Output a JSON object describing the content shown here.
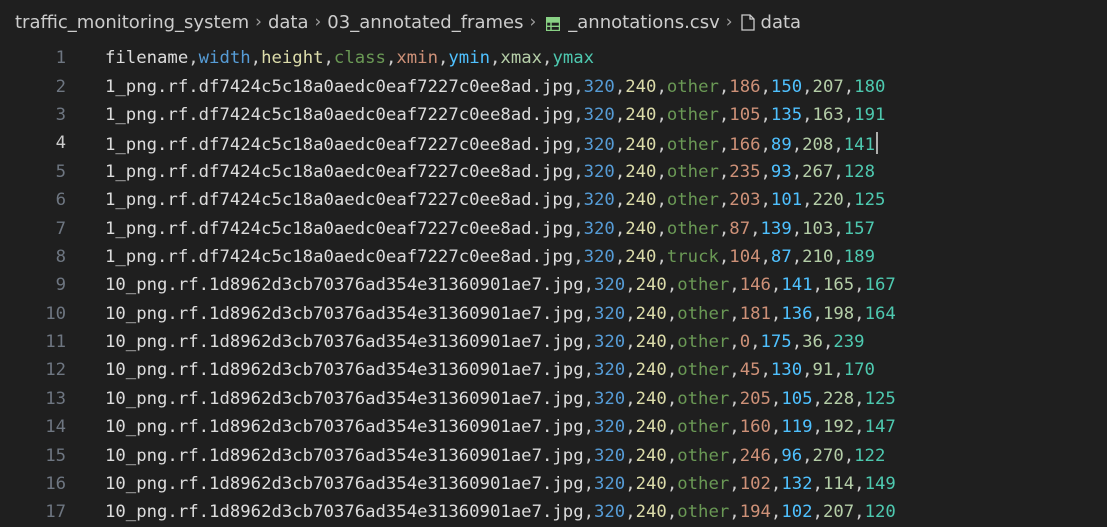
{
  "breadcrumb": {
    "items": [
      "traffic_monitoring_system",
      "data",
      "03_annotated_frames",
      "_annotations.csv",
      "data"
    ]
  },
  "colors": {
    "col0": "#dcdcdc",
    "col1": "#569cd6",
    "col2": "#dcdcaa",
    "col3": "#6a9955",
    "col4": "#ce9178",
    "col5": "#4fc1ff",
    "col6": "#b5cea8",
    "col7": "#4ec9b0",
    "comma": "#cccccc",
    "csv_icon": "#89d185"
  },
  "editor": {
    "active_line": 4,
    "lines": [
      {
        "n": "1",
        "cells": [
          "filename",
          "width",
          "height",
          "class",
          "xmin",
          "ymin",
          "xmax",
          "ymax"
        ]
      },
      {
        "n": "2",
        "cells": [
          "1_png.rf.df7424c5c18a0aedc0eaf7227c0ee8ad.jpg",
          "320",
          "240",
          "other",
          "186",
          "150",
          "207",
          "180"
        ]
      },
      {
        "n": "3",
        "cells": [
          "1_png.rf.df7424c5c18a0aedc0eaf7227c0ee8ad.jpg",
          "320",
          "240",
          "other",
          "105",
          "135",
          "163",
          "191"
        ]
      },
      {
        "n": "4",
        "cells": [
          "1_png.rf.df7424c5c18a0aedc0eaf7227c0ee8ad.jpg",
          "320",
          "240",
          "other",
          "166",
          "89",
          "208",
          "141"
        ]
      },
      {
        "n": "5",
        "cells": [
          "1_png.rf.df7424c5c18a0aedc0eaf7227c0ee8ad.jpg",
          "320",
          "240",
          "other",
          "235",
          "93",
          "267",
          "128"
        ]
      },
      {
        "n": "6",
        "cells": [
          "1_png.rf.df7424c5c18a0aedc0eaf7227c0ee8ad.jpg",
          "320",
          "240",
          "other",
          "203",
          "101",
          "220",
          "125"
        ]
      },
      {
        "n": "7",
        "cells": [
          "1_png.rf.df7424c5c18a0aedc0eaf7227c0ee8ad.jpg",
          "320",
          "240",
          "other",
          "87",
          "139",
          "103",
          "157"
        ]
      },
      {
        "n": "8",
        "cells": [
          "1_png.rf.df7424c5c18a0aedc0eaf7227c0ee8ad.jpg",
          "320",
          "240",
          "truck",
          "104",
          "87",
          "210",
          "189"
        ]
      },
      {
        "n": "9",
        "cells": [
          "10_png.rf.1d8962d3cb70376ad354e31360901ae7.jpg",
          "320",
          "240",
          "other",
          "146",
          "141",
          "165",
          "167"
        ]
      },
      {
        "n": "10",
        "cells": [
          "10_png.rf.1d8962d3cb70376ad354e31360901ae7.jpg",
          "320",
          "240",
          "other",
          "181",
          "136",
          "198",
          "164"
        ]
      },
      {
        "n": "11",
        "cells": [
          "10_png.rf.1d8962d3cb70376ad354e31360901ae7.jpg",
          "320",
          "240",
          "other",
          "0",
          "175",
          "36",
          "239"
        ]
      },
      {
        "n": "12",
        "cells": [
          "10_png.rf.1d8962d3cb70376ad354e31360901ae7.jpg",
          "320",
          "240",
          "other",
          "45",
          "130",
          "91",
          "170"
        ]
      },
      {
        "n": "13",
        "cells": [
          "10_png.rf.1d8962d3cb70376ad354e31360901ae7.jpg",
          "320",
          "240",
          "other",
          "205",
          "105",
          "228",
          "125"
        ]
      },
      {
        "n": "14",
        "cells": [
          "10_png.rf.1d8962d3cb70376ad354e31360901ae7.jpg",
          "320",
          "240",
          "other",
          "160",
          "119",
          "192",
          "147"
        ]
      },
      {
        "n": "15",
        "cells": [
          "10_png.rf.1d8962d3cb70376ad354e31360901ae7.jpg",
          "320",
          "240",
          "other",
          "246",
          "96",
          "270",
          "122"
        ]
      },
      {
        "n": "16",
        "cells": [
          "10_png.rf.1d8962d3cb70376ad354e31360901ae7.jpg",
          "320",
          "240",
          "other",
          "102",
          "132",
          "114",
          "149"
        ]
      },
      {
        "n": "17",
        "cells": [
          "10_png.rf.1d8962d3cb70376ad354e31360901ae7.jpg",
          "320",
          "240",
          "other",
          "194",
          "102",
          "207",
          "120"
        ]
      }
    ]
  }
}
